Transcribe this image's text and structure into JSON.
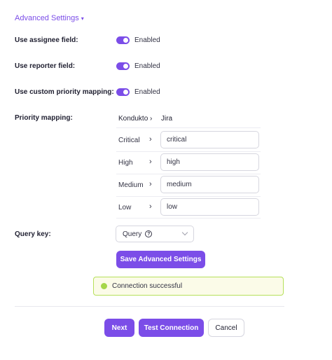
{
  "advanced": {
    "label": "Advanced Settings",
    "caret": "▾"
  },
  "fields": {
    "assignee_label": "Use assignee field:",
    "reporter_label": "Use reporter field:",
    "custom_priority_label": "Use custom priority mapping:",
    "enabled_text": "Enabled",
    "priority_mapping_label": "Priority mapping:",
    "query_key_label": "Query key:"
  },
  "mapping": {
    "source_header": "Kondukto",
    "arrow": "›",
    "target_header": "Jira",
    "rows": [
      {
        "source": "Critical",
        "target": "critical"
      },
      {
        "source": "High",
        "target": "high"
      },
      {
        "source": "Medium",
        "target": "medium"
      },
      {
        "source": "Low",
        "target": "low"
      }
    ]
  },
  "query": {
    "value": "Query",
    "help_icon": "?"
  },
  "buttons": {
    "save_advanced": "Save Advanced Settings",
    "next": "Next",
    "test_connection": "Test Connection",
    "cancel": "Cancel"
  },
  "status": {
    "message": "Connection successful"
  },
  "colors": {
    "accent": "#7b4de8",
    "success_border": "#b6e05a",
    "success_bg": "#fbfbe8"
  }
}
